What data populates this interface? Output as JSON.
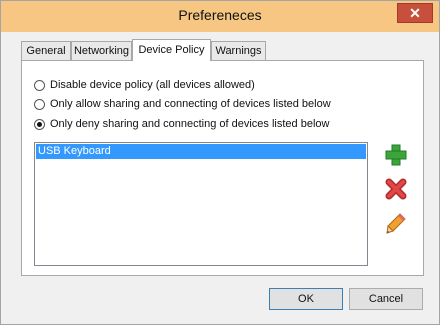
{
  "window": {
    "title": "Prefereneces",
    "close_glyph": "✕"
  },
  "tabs": [
    {
      "label": "General"
    },
    {
      "label": "Networking"
    },
    {
      "label": "Device Policy",
      "active": true
    },
    {
      "label": "Warnings"
    }
  ],
  "policy": {
    "options": [
      {
        "label": "Disable device policy (all devices allowed)",
        "selected": false
      },
      {
        "label": "Only allow sharing and connecting of devices listed below",
        "selected": false
      },
      {
        "label": "Only deny sharing and connecting of devices listed below",
        "selected": true
      }
    ],
    "devices": [
      {
        "name": "USB Keyboard",
        "selected": true
      }
    ]
  },
  "actions": {
    "add_icon": "plus-icon",
    "remove_icon": "x-icon",
    "edit_icon": "pencil-icon"
  },
  "buttons": {
    "ok": "OK",
    "cancel": "Cancel"
  },
  "colors": {
    "titlebar": "#f6c682",
    "close": "#c7503d",
    "selection": "#3399ff"
  }
}
